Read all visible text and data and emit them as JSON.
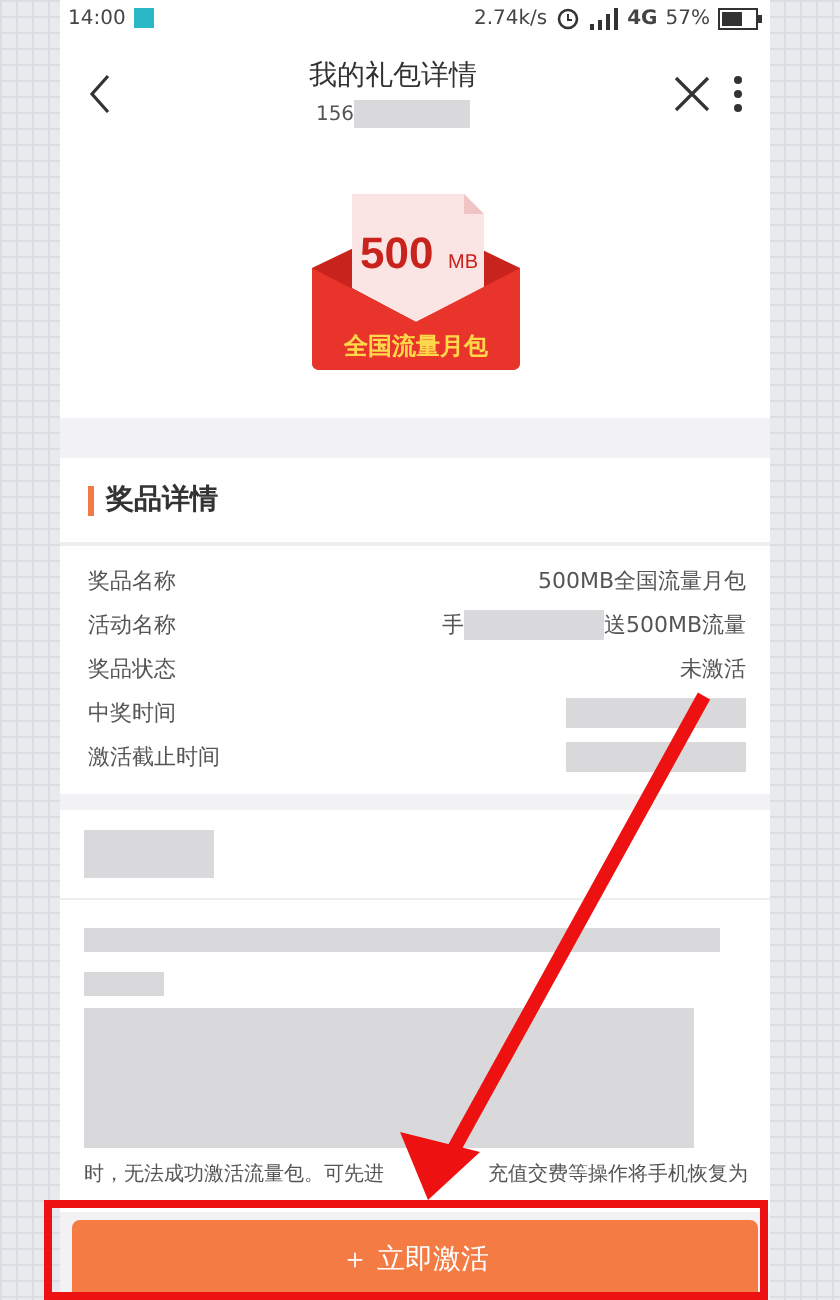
{
  "status_bar": {
    "time": "14:00",
    "speed": "2.74k/s",
    "network": "4G",
    "battery": "57%"
  },
  "header": {
    "title": "我的礼包详情",
    "subtitle": "156"
  },
  "prize_image": {
    "amount": "500",
    "unit": "MB",
    "caption": "全国流量月包"
  },
  "details": {
    "heading": "奖品详情",
    "rows": [
      {
        "label": "奖品名称",
        "value": "500MB全国流量月包"
      },
      {
        "label": "活动名称",
        "value_start": "手",
        "value": "送500MB流量"
      },
      {
        "label": "奖品状态",
        "value": "未激活"
      },
      {
        "label": "中奖时间"
      },
      {
        "label": "激活截止时间"
      }
    ]
  },
  "notice": {
    "text_before": "时，无法成功激活流量包。可先进",
    "text_after": "充值交费等操作将手机恢复为"
  },
  "action_button": {
    "icon": "＋",
    "label": "立即激活"
  }
}
